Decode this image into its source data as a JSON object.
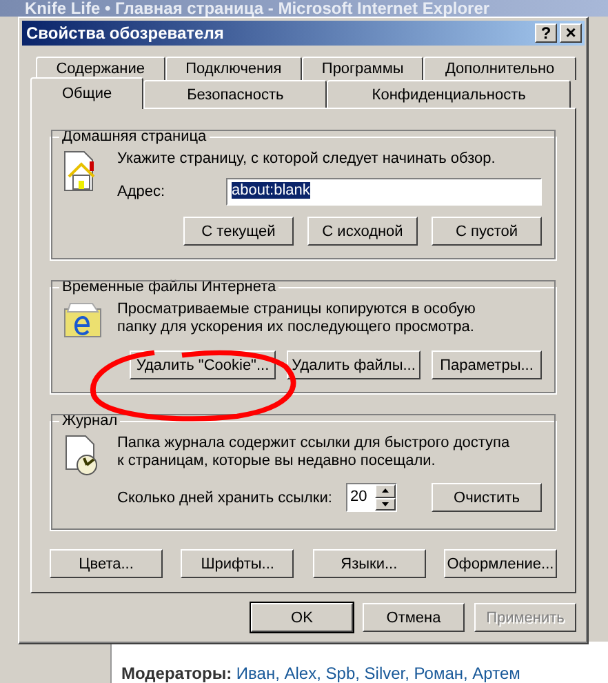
{
  "background_window": {
    "title": "Knife Life • Главная страница - Microsoft Internet Explorer",
    "footer_text": "**Модераторы:** Иван, Alex, Spb, Silver, Роман, Артем"
  },
  "dialog": {
    "title": "Свойства обозревателя",
    "title_buttons": [
      {
        "kind": "help",
        "label": "?"
      },
      {
        "kind": "close",
        "label": "×"
      }
    ]
  },
  "tab_rows": [
    [
      {
        "label": "Содержание",
        "selected": false
      },
      {
        "label": "Подключения",
        "selected": false
      },
      {
        "label": "Программы",
        "selected": false
      },
      {
        "label": "Дополнительно",
        "selected": false
      }
    ],
    [
      {
        "label": "Общие",
        "selected": true
      },
      {
        "label": "Безопасность",
        "selected": false
      },
      {
        "label": "Конфиденциальность",
        "selected": false
      }
    ]
  ],
  "home_page": {
    "title": "Домашняя страница",
    "description": "Укажите страницу, с которой следует начинать обзор.",
    "address_label": "Адрес:",
    "address_value": "about:blank",
    "address_selected": true,
    "buttons": [
      "С текущей",
      "С исходной",
      "С пустой"
    ]
  },
  "temp_files": {
    "title": "Временные файлы Интернета",
    "description": "Просматриваемые страницы копируются в особую папку для ускорения их последующего просмотра.",
    "buttons": [
      "Удалить \"Cookie\"...",
      "Удалить файлы...",
      "Параметры..."
    ]
  },
  "history": {
    "title": "Журнал",
    "description": "Папка журнала содержит ссылки для быстрого доступа к страницам, которые вы недавно посещали.",
    "days_label": "Сколько дней хранить ссылки:",
    "days_value": "20",
    "clear_button": "Очистить"
  },
  "appearance_buttons": [
    "Цвета...",
    "Шрифты...",
    "Языки...",
    "Оформление..."
  ],
  "dialog_buttons": [
    {
      "label": "OK",
      "default": true,
      "disabled": false
    },
    {
      "label": "Отмена",
      "default": false,
      "disabled": false
    },
    {
      "label": "Применить",
      "default": false,
      "disabled": true
    }
  ]
}
